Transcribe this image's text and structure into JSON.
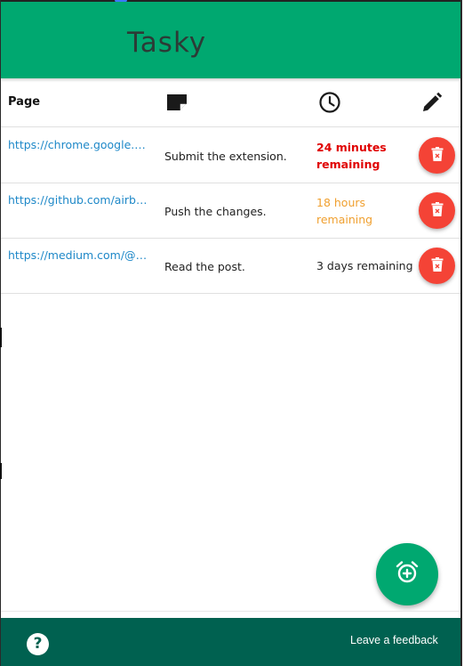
{
  "app": {
    "title": "Tasky"
  },
  "table": {
    "headers": {
      "page_label": "Page",
      "note_icon": "note-icon",
      "time_icon": "clock-icon",
      "actions_icon": "pencil-icon"
    },
    "rows": [
      {
        "url": "https://chrome.google.com/webstore/devconsole",
        "note": "Submit the extension.",
        "time_line1": "24 minutes",
        "time_line2": "remaining",
        "time_color": "#e00000",
        "time_bold": true
      },
      {
        "url": "https://github.com/airbnb/javascript",
        "note": "Push the changes.",
        "time_line1": "18 hours",
        "time_line2": "remaining",
        "time_color": "#f0a030",
        "time_bold": false
      },
      {
        "url": "https://medium.com/@ui-design",
        "note": "Read the post.",
        "time_line1": "3 days remaining",
        "time_line2": "",
        "time_color": "#222222",
        "time_bold": false
      }
    ]
  },
  "fab": {
    "icon": "alarm-add-icon"
  },
  "footer": {
    "help_icon": "help-icon",
    "feedback_label": "Leave a feedback"
  },
  "colors": {
    "primary": "#00a870",
    "footer": "#006150",
    "danger": "#f44336",
    "link": "#1e88c8"
  }
}
